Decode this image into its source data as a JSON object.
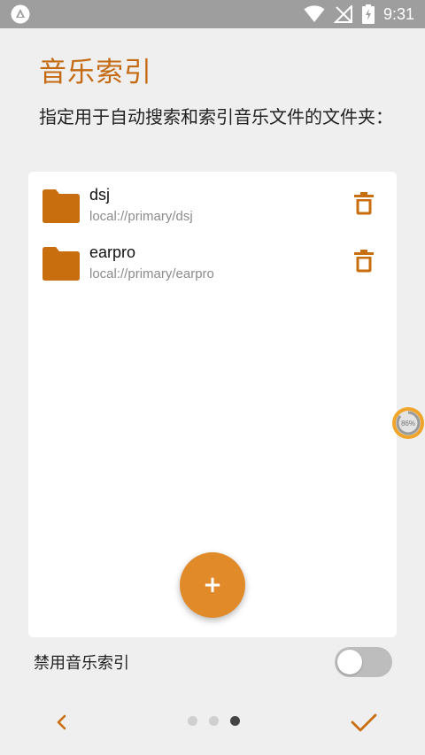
{
  "status_bar": {
    "time": "9:31"
  },
  "page": {
    "title": "音乐索引",
    "description": "指定用于自动搜索和索引音乐文件的文件夹："
  },
  "folders": [
    {
      "name": "dsj",
      "path": "local://primary/dsj"
    },
    {
      "name": "earpro",
      "path": "local://primary/earpro"
    }
  ],
  "add_button": {
    "label": "+"
  },
  "progress_badge": {
    "label": "86%",
    "value": 0.86
  },
  "settings": {
    "disable_label": "禁用音乐索引",
    "disable_enabled": false
  },
  "pager": {
    "total": 3,
    "active_index": 2
  },
  "colors": {
    "accent": "#c46a12",
    "fab": "#e08a2a",
    "folder": "#c96e0e"
  }
}
